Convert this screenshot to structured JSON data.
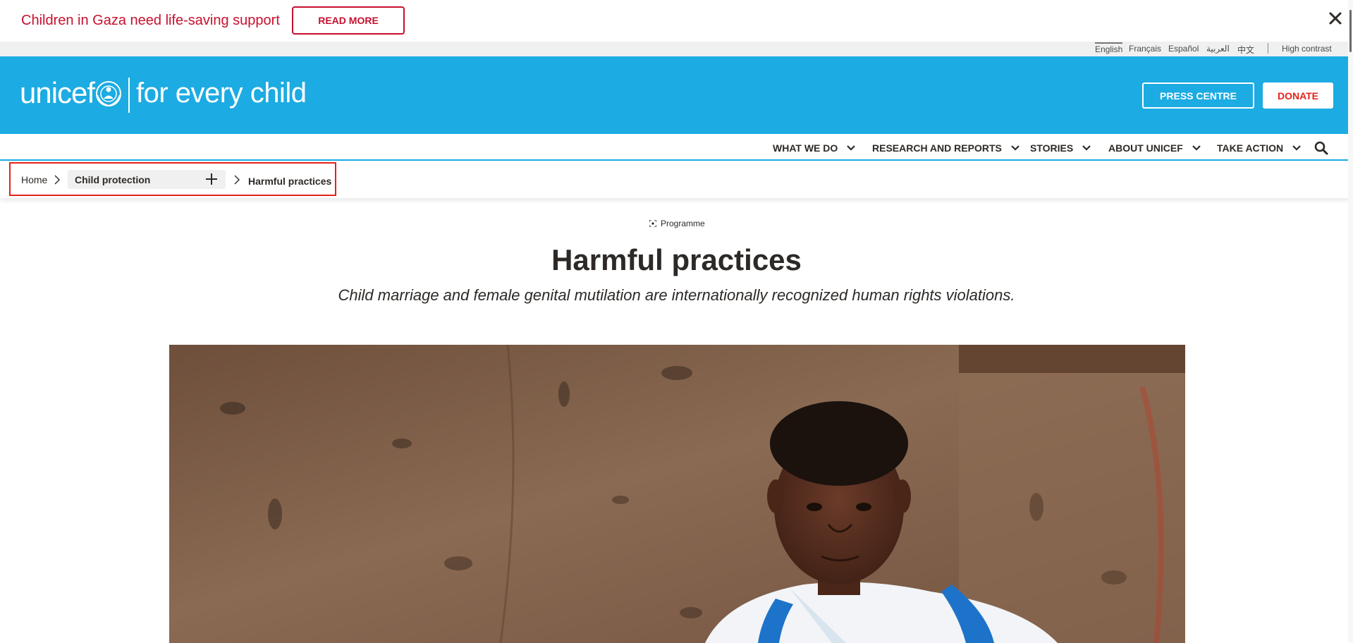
{
  "alert": {
    "message": "Children in Gaza need life-saving support",
    "read_more_label": "READ MORE"
  },
  "languages": {
    "items": [
      "English",
      "Français",
      "Español",
      "العربية",
      "中文"
    ],
    "active": "English",
    "high_contrast_label": "High contrast"
  },
  "header": {
    "logo_text": "unicef",
    "tagline": "for every child",
    "press_label": "PRESS CENTRE",
    "donate_label": "DONATE"
  },
  "nav": {
    "items": [
      {
        "label": "WHAT WE DO"
      },
      {
        "label": "RESEARCH AND REPORTS"
      },
      {
        "label": "STORIES"
      },
      {
        "label": "ABOUT UNICEF"
      },
      {
        "label": "TAKE ACTION"
      }
    ]
  },
  "breadcrumb": {
    "home": "Home",
    "section": "Child protection",
    "current": "Harmful practices"
  },
  "content": {
    "tag": "Programme",
    "title": "Harmful practices",
    "subtitle": "Child marriage and female genital mutilation are internationally recognized human rights violations."
  },
  "colors": {
    "unicef_blue": "#1cabe2",
    "alert_red": "#c8102e",
    "donate_red": "#e2231a",
    "text_dark": "#2d2926"
  }
}
